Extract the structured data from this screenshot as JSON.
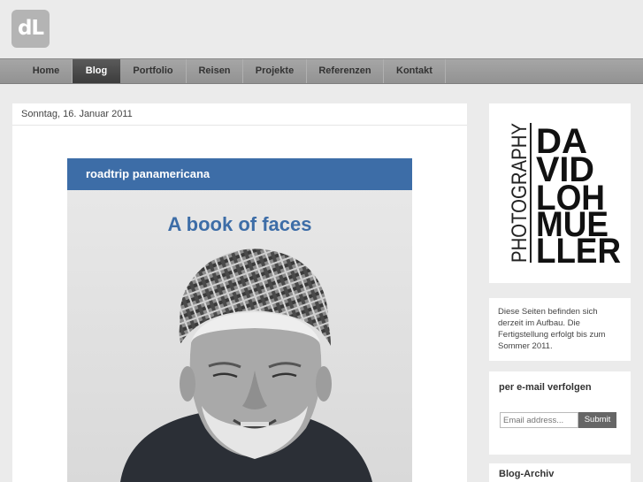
{
  "logo": {
    "text": "dL"
  },
  "nav": {
    "items": [
      {
        "label": "Home",
        "active": false
      },
      {
        "label": "Blog",
        "active": true
      },
      {
        "label": "Portfolio",
        "active": false
      },
      {
        "label": "Reisen",
        "active": false
      },
      {
        "label": "Projekte",
        "active": false
      },
      {
        "label": "Referenzen",
        "active": false
      },
      {
        "label": "Kontakt",
        "active": false
      }
    ]
  },
  "post": {
    "date": "Sonntag, 16. Januar 2011",
    "book_bar": "roadtrip panamericana",
    "book_title": "A book of faces"
  },
  "sidebar": {
    "brand": {
      "vertical": "PHOTOGRAPHY",
      "lines": [
        "DA",
        "VID",
        "LOH",
        "MUE",
        "LLER"
      ]
    },
    "info": "Diese Seiten befinden sich derzeit im Aufbau. Die Fertigstellung erfolgt bis zum Sommer 2011.",
    "email": {
      "title": "per e-mail verfolgen",
      "placeholder": "Email address...",
      "button": "Submit"
    },
    "archive": {
      "title": "Blog-Archiv"
    }
  },
  "colors": {
    "accent": "#3d6da7",
    "nav_active": "#3c3c3c"
  }
}
